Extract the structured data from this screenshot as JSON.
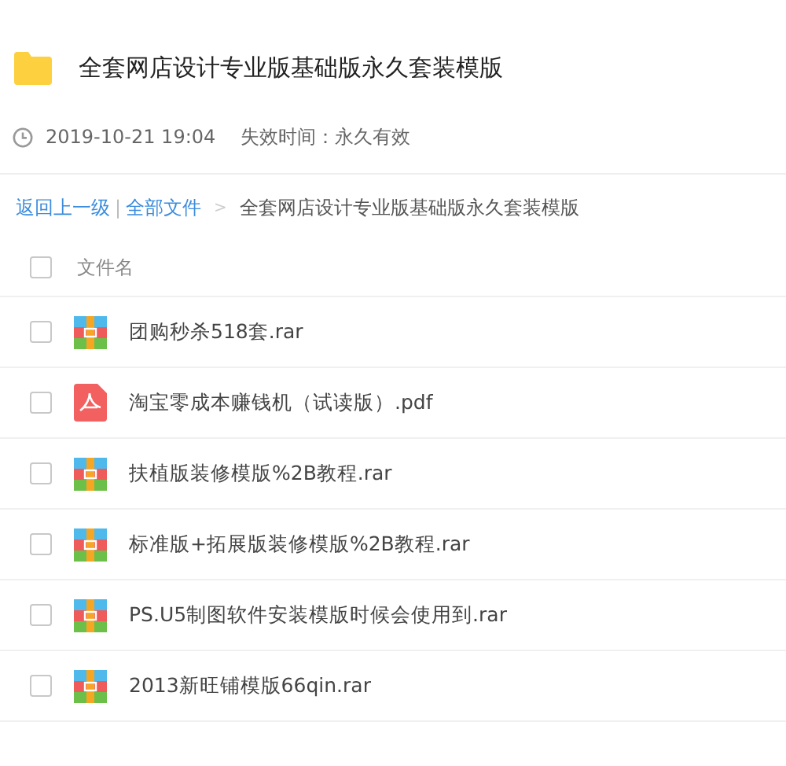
{
  "folder": {
    "title": "全套网店设计专业版基础版永久套装模版"
  },
  "meta": {
    "time": "2019-10-21 19:04",
    "expiry": "失效时间：永久有效"
  },
  "breadcrumb": {
    "back": "返回上一级",
    "separator": "|",
    "all": "全部文件",
    "arrow": ">",
    "current": "全套网店设计专业版基础版永久套装模版"
  },
  "header": {
    "label": "文件名",
    "checked": false
  },
  "files": [
    {
      "name": "团购秒杀518套.rar",
      "kind": "rar",
      "checked": false
    },
    {
      "name": "淘宝零成本赚钱机（试读版）.pdf",
      "kind": "pdf",
      "checked": false
    },
    {
      "name": "扶植版装修模版%2B教程.rar",
      "kind": "rar",
      "checked": false
    },
    {
      "name": "标准版+拓展版装修模版%2B教程.rar",
      "kind": "rar",
      "checked": false
    },
    {
      "name": "PS.U5制图软件安装模版时候会使用到.rar",
      "kind": "rar",
      "checked": false
    },
    {
      "name": "2013新旺铺模版66qin.rar",
      "kind": "rar",
      "checked": false
    }
  ]
}
